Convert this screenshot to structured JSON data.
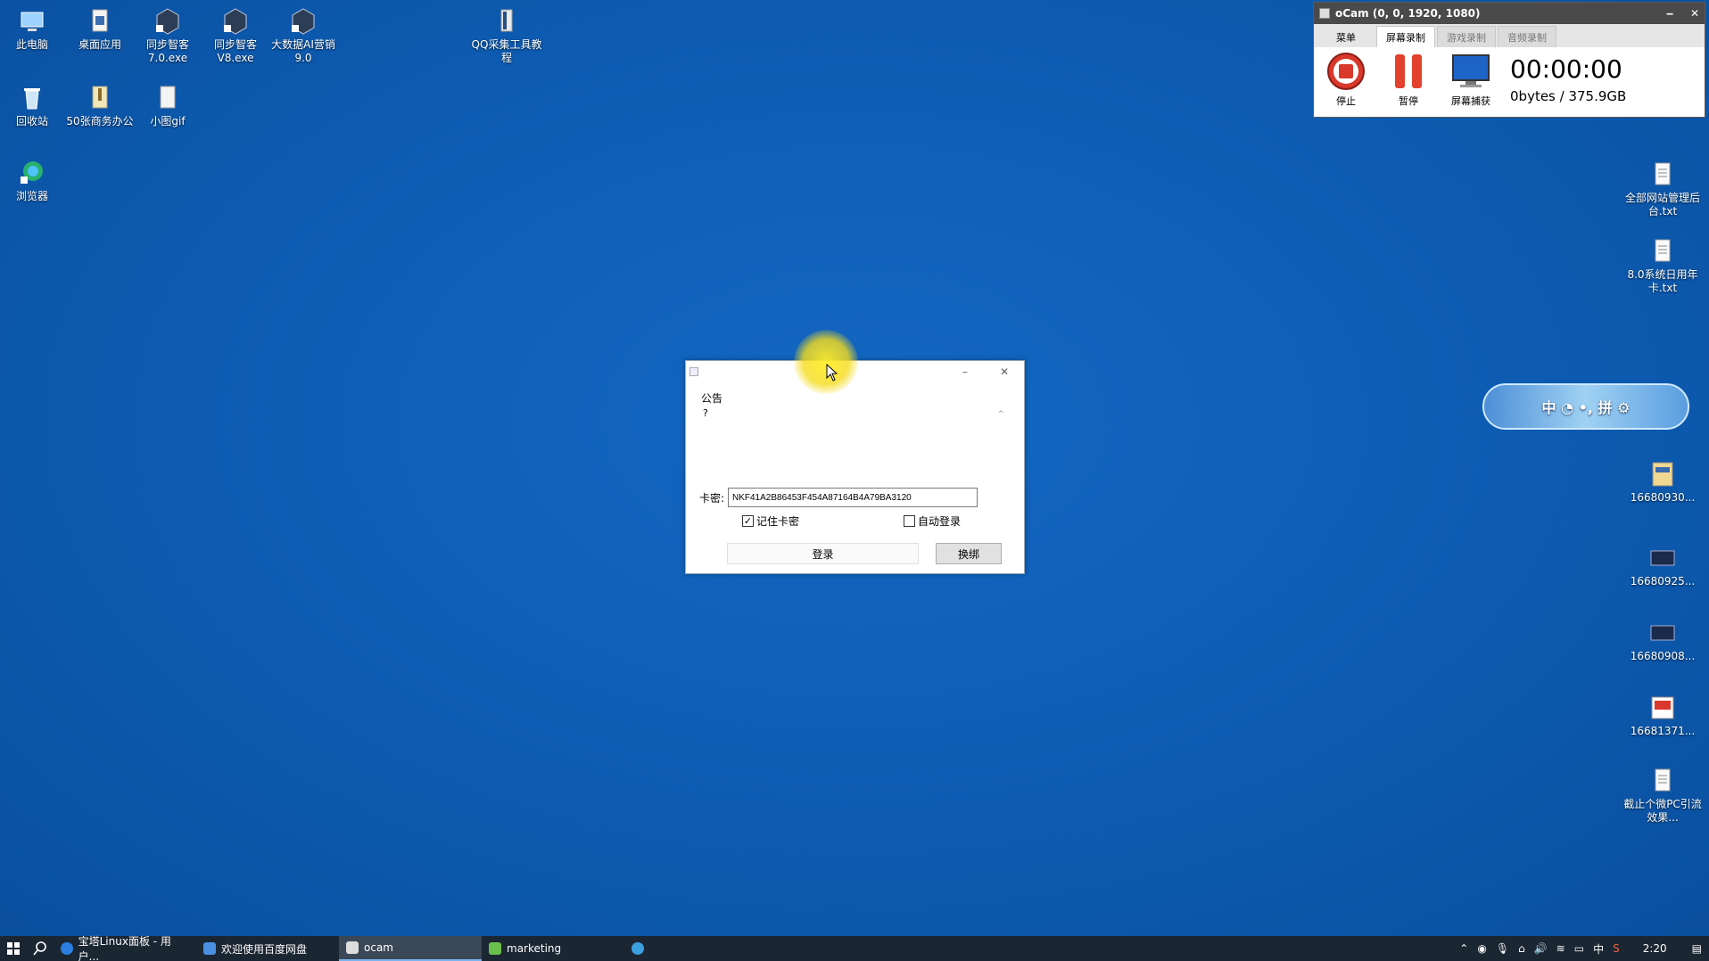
{
  "desktop": {
    "left_icons": [
      {
        "label": "此电脑",
        "icon": "computer-icon"
      },
      {
        "label": "桌面应用",
        "icon": "file-icon"
      },
      {
        "label": "同步智客 7.0.exe",
        "icon": "app-icon"
      },
      {
        "label": "同步智客 V8.exe",
        "icon": "app-icon"
      },
      {
        "label": "大数据AI营销 9.0",
        "icon": "app-icon"
      },
      {
        "label": "QQ采集工具教程",
        "icon": "file-icon"
      },
      {
        "label": "回收站",
        "icon": "recycle-bin-icon"
      },
      {
        "label": "50张商务办公",
        "icon": "archive-icon"
      },
      {
        "label": "小图gif",
        "icon": "file-icon"
      },
      {
        "label": "浏览器",
        "icon": "browser-icon"
      }
    ],
    "right_icons": [
      {
        "label": "全部网站管理后台.txt",
        "icon": "text-file-icon"
      },
      {
        "label": "8.0系统日用年卡.txt",
        "icon": "text-file-icon"
      },
      {
        "label": "16680930...",
        "icon": "image-file-icon"
      },
      {
        "label": "16680925...",
        "icon": "image-file-icon"
      },
      {
        "label": "16680908...",
        "icon": "image-file-icon"
      },
      {
        "label": "16681371...",
        "icon": "image-file-icon"
      },
      {
        "label": "截止个微PC引流效果...",
        "icon": "text-file-icon"
      }
    ],
    "widget_text": "中 ◔ •, 拼 ⚙"
  },
  "ocam": {
    "title": "oCam (0, 0, 1920, 1080)",
    "tabs": [
      "菜单",
      "屏幕录制",
      "游戏录制",
      "音频录制"
    ],
    "active_tab": "屏幕录制",
    "tools": [
      {
        "label": "停止",
        "icon": "stop-icon"
      },
      {
        "label": "暂停",
        "icon": "pause-icon"
      },
      {
        "label": "屏幕捕获",
        "icon": "screen-capture-icon"
      }
    ],
    "time": "00:00:00",
    "size": "0bytes / 375.9GB"
  },
  "dialog": {
    "notice_title": "公告",
    "notice_body": "?",
    "card_label": "卡密:",
    "card_value": "NKF41A2B86453F454A87164B4A79BA3120",
    "remember_label": "记住卡密",
    "remember_checked": true,
    "autologin_label": "自动登录",
    "autologin_checked": false,
    "login_label": "登录",
    "unbind_label": "换绑"
  },
  "taskbar": {
    "tasks": [
      {
        "label": "宝塔Linux面板 - 用户...",
        "color": "#2a7fe0"
      },
      {
        "label": "欢迎使用百度网盘",
        "color": "#4a90e2"
      },
      {
        "label": "ocam",
        "color": "#dddddd",
        "active": true
      },
      {
        "label": "marketing",
        "color": "#6ac04a"
      },
      {
        "label": "",
        "color": "#3aa0e0"
      }
    ],
    "tray_ime": "中",
    "clock": "2:20"
  }
}
